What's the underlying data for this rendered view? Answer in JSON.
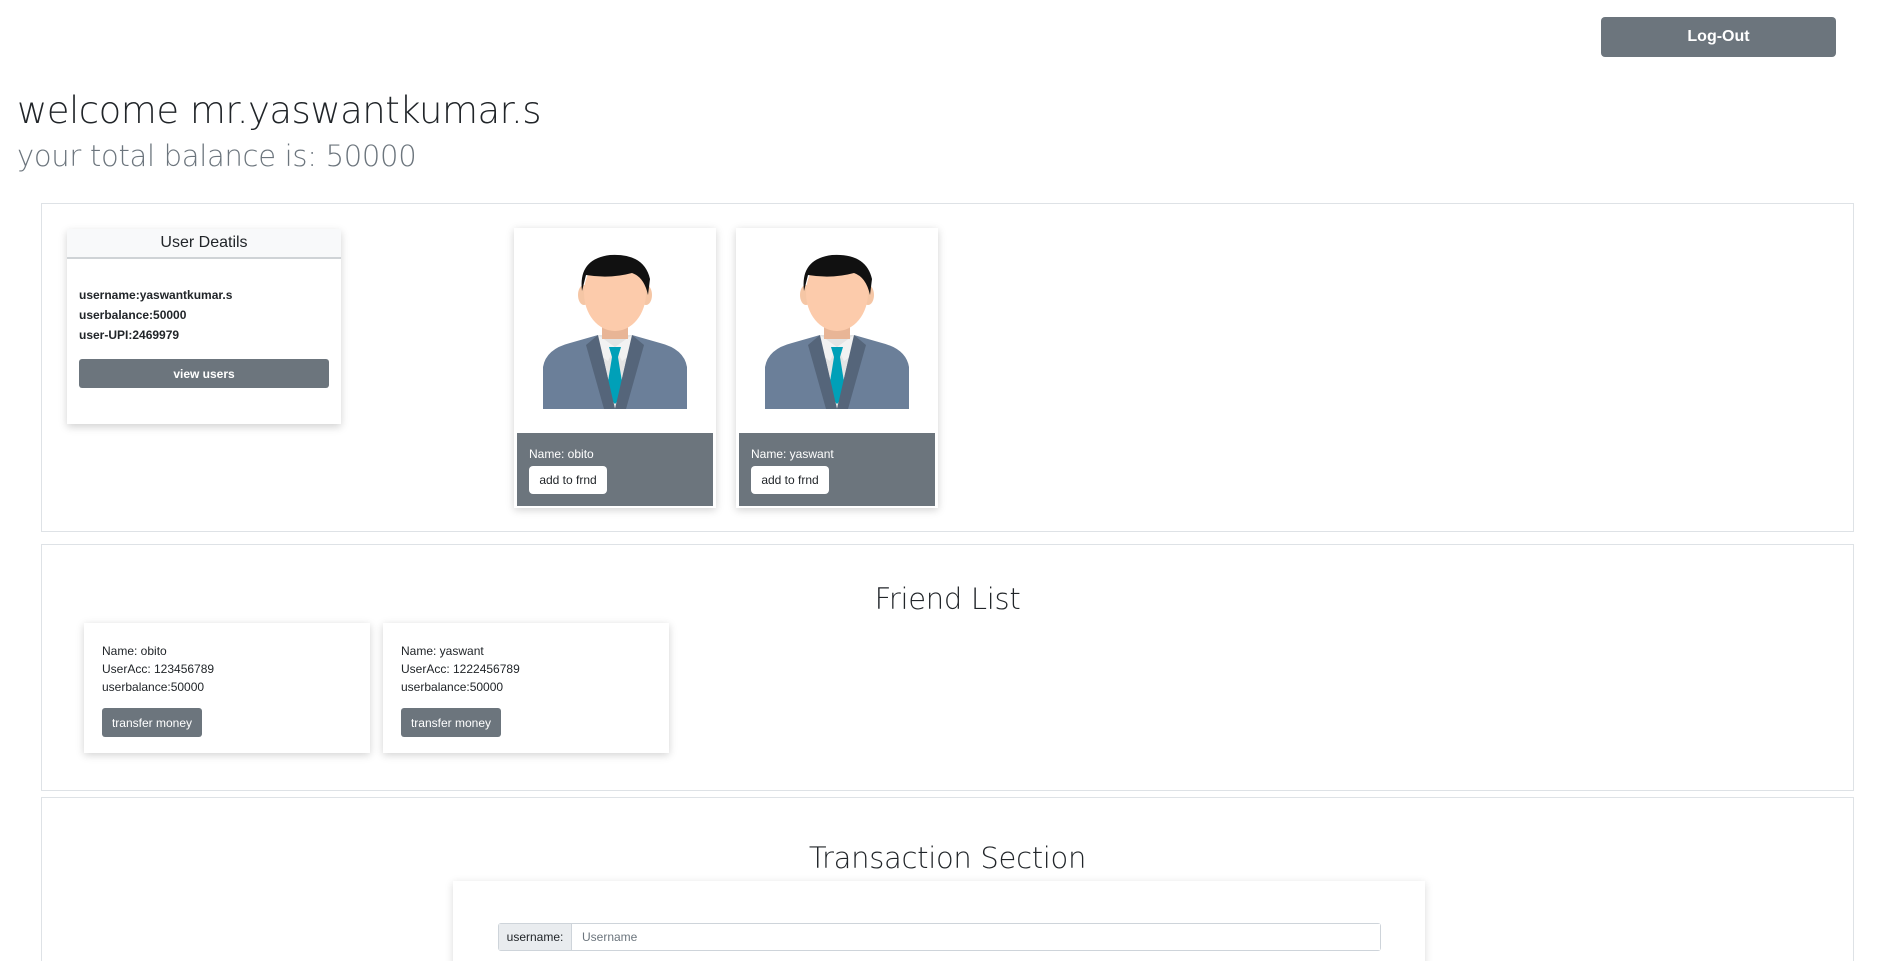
{
  "header": {
    "logout_label": "Log-Out",
    "welcome": "welcome mr.yaswantkumar.s",
    "balance": "your total balance is: 50000"
  },
  "user_details": {
    "title": "User Deatils",
    "username": "username:yaswantkumar.s",
    "balance": "userbalance:50000",
    "upi": "user-UPI:2469979",
    "view_users_label": "view users"
  },
  "users": [
    {
      "name": "Name: obito",
      "button": "add to frnd",
      "avatar": "businessman-avatar-icon"
    },
    {
      "name": "Name: yaswant",
      "button": "add to frnd",
      "avatar": "businessman-avatar-icon"
    }
  ],
  "friends": {
    "title": "Friend List",
    "items": [
      {
        "name": "Name: obito",
        "acc": "UserAcc: 123456789",
        "balance": "userbalance:50000",
        "button": "transfer money"
      },
      {
        "name": "Name: yaswant",
        "acc": "UserAcc: 1222456789",
        "balance": "userbalance:50000",
        "button": "transfer money"
      }
    ]
  },
  "transaction": {
    "title": "Transaction Section",
    "username_label": "username:",
    "username_placeholder": "Username"
  },
  "colors": {
    "secondary": "#6c757d",
    "border": "#dee2e6",
    "tie": "#00a0b8",
    "suit": "#6b7f99"
  }
}
